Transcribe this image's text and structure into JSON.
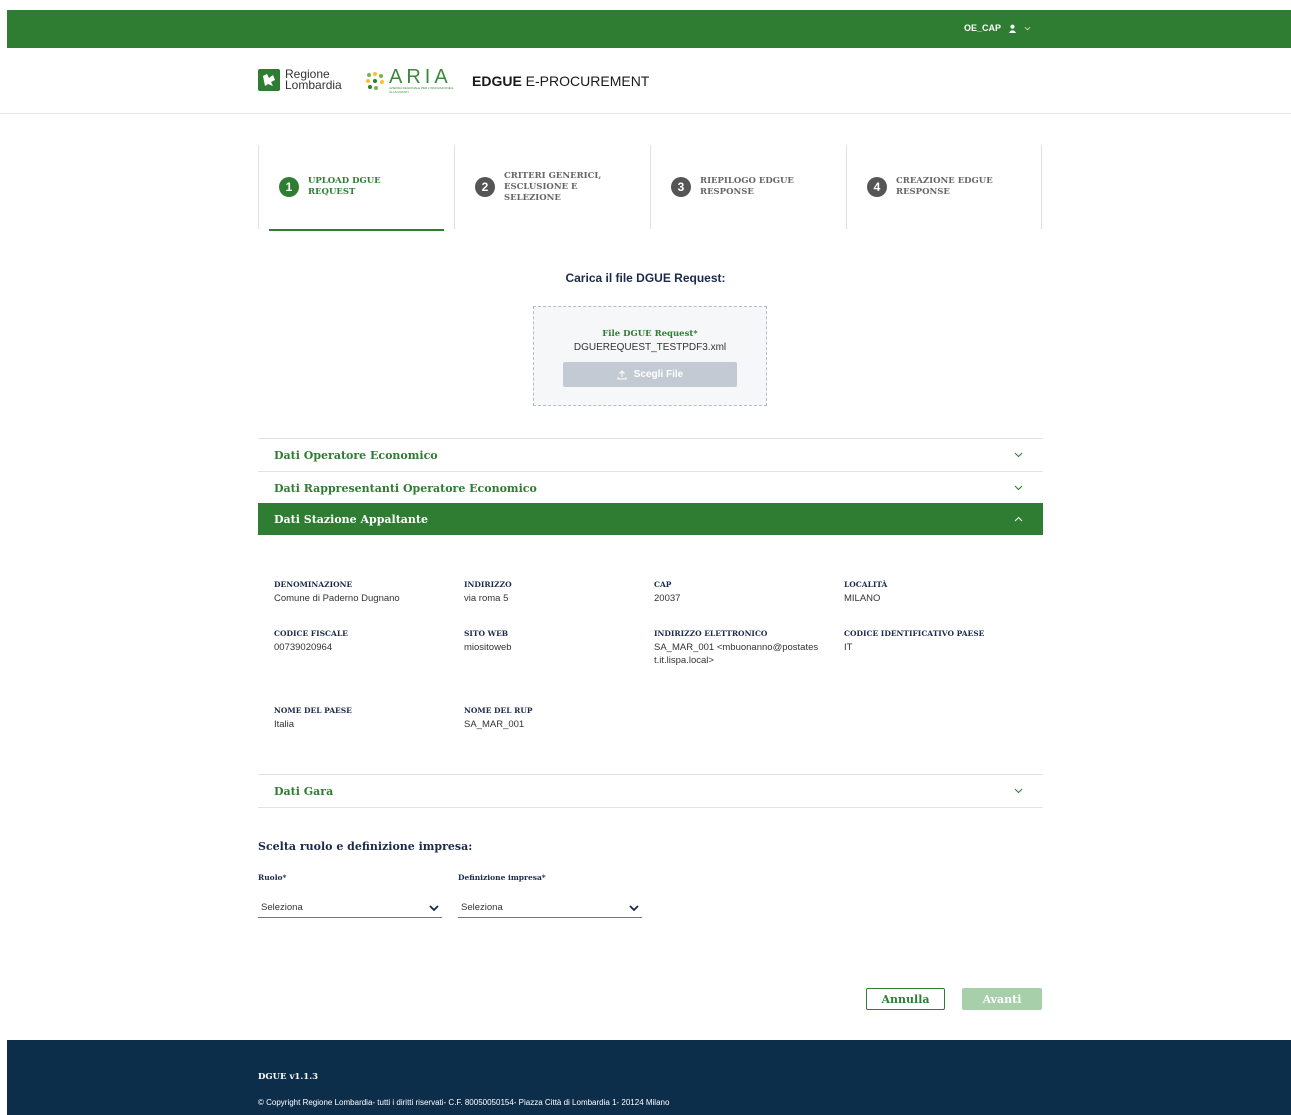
{
  "topbar": {
    "user": "OE_CAP"
  },
  "header": {
    "logo_region_line1": "Regione",
    "logo_region_line2": "Lombardia",
    "logo_aria": "ARIA",
    "logo_aria_sub": "AZIENDA REGIONALE PER L'INNOVAZIONE E GLI ACQUISTI",
    "title_bold": "EDGUE",
    "title_rest": " E-PROCUREMENT"
  },
  "steps": [
    {
      "num": "1",
      "label": "UPLOAD DGUE REQUEST"
    },
    {
      "num": "2",
      "label": "CRITERI GENERICI, ESCLUSIONE E SELEZIONE"
    },
    {
      "num": "3",
      "label": "RIEPILOGO EDGUE RESPONSE"
    },
    {
      "num": "4",
      "label": "CREAZIONE EDGUE RESPONSE"
    }
  ],
  "upload": {
    "title": "Carica il file DGUE Request:",
    "field_label": "File DGUE Request*",
    "file_name": "DGUEREQUEST_TESTPDF3.xml",
    "button": "Scegli File"
  },
  "accordion": {
    "operatore": "Dati Operatore Economico",
    "rappresentanti": "Dati Rappresentanti Operatore Economico",
    "stazione": "Dati Stazione Appaltante",
    "gara": "Dati Gara"
  },
  "stazione": {
    "denominazione_k": "DENOMINAZIONE",
    "denominazione_v": "Comune di Paderno Dugnano",
    "indirizzo_k": "INDIRIZZO",
    "indirizzo_v": "via roma 5",
    "cap_k": "CAP",
    "cap_v": "20037",
    "localita_k": "LOCALITÀ",
    "localita_v": "MILANO",
    "cf_k": "CODICE FISCALE",
    "cf_v": "00739020964",
    "sito_k": "SITO WEB",
    "sito_v": "miositoweb",
    "email_k": "INDIRIZZO ELETTRONICO",
    "email_v": "SA_MAR_001 <mbuonanno@postatest.it.lispa.local>",
    "paese_code_k": "CODICE IDENTIFICATIVO PAESE",
    "paese_code_v": "IT",
    "paese_k": "NOME DEL PAESE",
    "paese_v": "Italia",
    "rup_k": "NOME DEL RUP",
    "rup_v": "SA_MAR_001"
  },
  "choice": {
    "title": "Scelta ruolo e definizione impresa:",
    "ruolo_label": "Ruolo*",
    "ruolo_value": "Seleziona",
    "impresa_label": "Definizione impresa*",
    "impresa_value": "Seleziona"
  },
  "actions": {
    "cancel": "Annulla",
    "next": "Avanti"
  },
  "footer": {
    "version": "DGUE v1.1.3",
    "copyright": "© Copyright Regione Lombardia- tutti i diritti riservati- C.F. 80050050154- Piazza Città di Lombardia 1- 20124 Milano"
  },
  "colors": {
    "brand": "#2e7d32",
    "footer": "#0d2e4a",
    "navy": "#1b2a4a"
  }
}
